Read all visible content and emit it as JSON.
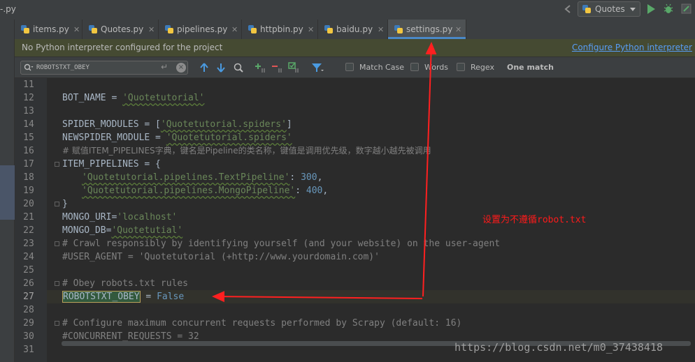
{
  "toolbar": {
    "breadcrumb": "-.py",
    "run_config": "Quotes"
  },
  "tabs": [
    {
      "name": "items.py",
      "active": false
    },
    {
      "name": "Quotes.py",
      "active": false
    },
    {
      "name": "pipelines.py",
      "active": false
    },
    {
      "name": "httpbin.py",
      "active": false
    },
    {
      "name": "baidu.py",
      "active": false
    },
    {
      "name": "settings.py",
      "active": true
    }
  ],
  "banner": {
    "message": "No Python interpreter configured for the project",
    "link": "Configure Python interpreter"
  },
  "find": {
    "query": "ROBOTSTXT_OBEY",
    "enter_glyph": "↵",
    "clear_glyph": "×",
    "match_case": "Match Case",
    "words": "Words",
    "regex": "Regex",
    "result": "One match"
  },
  "editor": {
    "line_numbers": [
      "11",
      "12",
      "13",
      "14",
      "15",
      "16",
      "17",
      "18",
      "19",
      "20",
      "21",
      "22",
      "23",
      "24",
      "25",
      "26",
      "27",
      "28",
      "29",
      "30",
      "31"
    ],
    "current_line": "27",
    "lines": {
      "l12_name": "BOT_NAME",
      "l12_op": " = ",
      "l12_val": "'Quotetutorial'",
      "l14_name": "SPIDER_MODULES",
      "l14_op": " = [",
      "l14_val": "'Quotetutorial.spiders'",
      "l14_end": "]",
      "l15_name": "NEWSPIDER_MODULE",
      "l15_op": " = ",
      "l15_val": "'Quotetutorial.spiders'",
      "l16_comment": "# 赋值ITEM_PIPELINES字典，键名是Pipeline的类名称，键值是调用优先级，数字越小越先被调用",
      "l17_code": "ITEM_PIPELINES = {",
      "l18_key": "'Quotetutorial.pipelines.TextPipeline'",
      "l18_colon": ": ",
      "l18_num": "300",
      "l18_end": ",",
      "l19_key": "'Quotetutorial.pipelines.MongoPipeline'",
      "l19_colon": ": ",
      "l19_num": "400",
      "l19_end": ",",
      "l20_code": "}",
      "l21_name": "MONGO_URI",
      "l21_op": "=",
      "l21_val": "'localhost'",
      "l22_name": "MONGO_DB",
      "l22_op": "=",
      "l22_val": "'Quotetutial'",
      "l23_comment": "# Crawl responsibly by identifying yourself (and your website) on the user-agent",
      "l24_comment": "#USER_AGENT = 'Quotetutorial (+http://www.yourdomain.com)'",
      "l26_comment": "# Obey robots.txt rules",
      "l27_name": "ROBOTSTXT_OBEY",
      "l27_op": " = ",
      "l27_val": "False",
      "l29_comment": "# Configure maximum concurrent requests performed by Scrapy (default: 16)",
      "l30_comment": "#CONCURRENT_REQUESTS = 32"
    }
  },
  "annotation": "设置为不遵循robot.txt",
  "watermark": "https://blog.csdn.net/m0_37438418",
  "colors": {
    "accent": "#4a88c7",
    "annotation": "#ff1a1a",
    "string": "#6a8759",
    "number": "#6897bb",
    "comment": "#808080"
  }
}
